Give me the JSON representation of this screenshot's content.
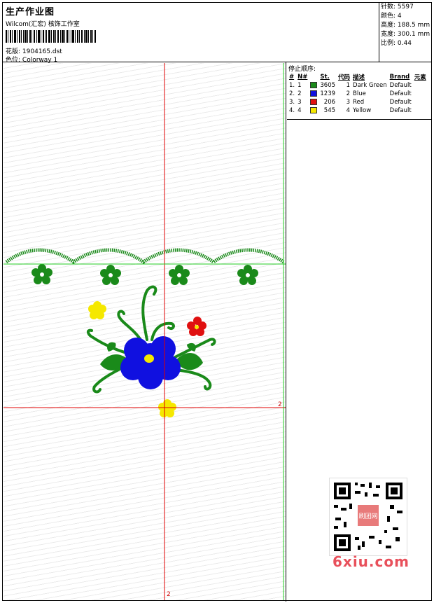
{
  "header": {
    "title": "生产作业图",
    "subtitle": "Wilcom(汇宏) 核饰工作室",
    "design_label": "花版:",
    "design_file": "1904165.dst",
    "colorway_label": "色位:",
    "colorway": "Colorway 1"
  },
  "stats": [
    {
      "label": "针数:",
      "value": "5597"
    },
    {
      "label": "颜色:",
      "value": "4"
    },
    {
      "label": "高度:",
      "value": "188.5 mm"
    },
    {
      "label": "宽度:",
      "value": "300.1 mm"
    },
    {
      "label": "比例:",
      "value": "0.44"
    }
  ],
  "stop_sequence": {
    "title": "停止顺序:",
    "columns": [
      "#",
      "N#",
      "St.",
      "代码",
      "描述",
      "Brand",
      "元素"
    ],
    "rows": [
      {
        "idx": "1.",
        "n": "1",
        "stitches": "3605",
        "code": "1",
        "desc": "Dark Green",
        "brand": "Default",
        "color": "#1a8a1a"
      },
      {
        "idx": "2.",
        "n": "2",
        "stitches": "1239",
        "code": "2",
        "desc": "Blue",
        "brand": "Default",
        "color": "#1010e0"
      },
      {
        "idx": "3.",
        "n": "3",
        "stitches": "206",
        "code": "3",
        "desc": "Red",
        "brand": "Default",
        "color": "#e01010"
      },
      {
        "idx": "4.",
        "n": "4",
        "stitches": "545",
        "code": "4",
        "desc": "Yellow",
        "brand": "Default",
        "color": "#f5e800"
      }
    ]
  },
  "guides": {
    "h_label": "2",
    "v_label": "2"
  },
  "watermark": {
    "site": "6xiu.com",
    "seal": "刷团网"
  },
  "colors": {
    "green": "#1a8a1a",
    "blue": "#1010e0",
    "red": "#e01010",
    "yellow": "#f5e800",
    "guide_red": "#e00000",
    "guide_green": "#22cc22"
  }
}
